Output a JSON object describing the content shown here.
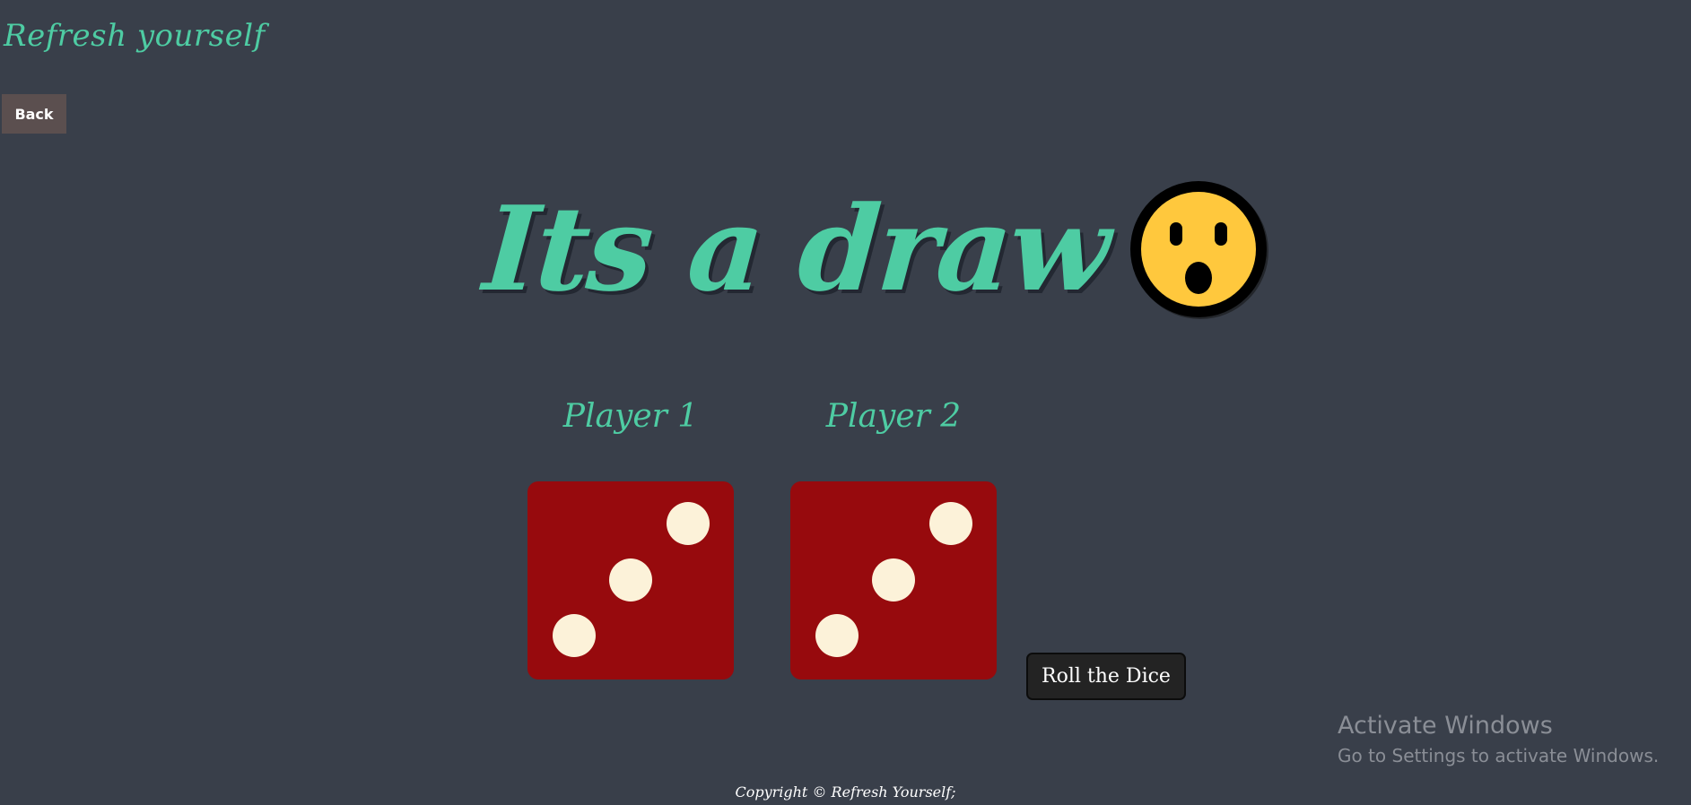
{
  "header": {
    "brand": "Refresh yourself",
    "back_label": "Back"
  },
  "result": {
    "headline": "Its a draw",
    "emoji": "astonished-face-emoji"
  },
  "players": [
    {
      "label": "Player 1",
      "die_value": 3
    },
    {
      "label": "Player 2",
      "die_value": 3
    }
  ],
  "controls": {
    "roll_label": "Roll the Dice"
  },
  "watermark": {
    "title": "Activate Windows",
    "subtitle": "Go to Settings to activate Windows."
  },
  "footer": {
    "copyright": "Copyright © Refresh Yourself;"
  },
  "colors": {
    "background": "#393f4a",
    "accent": "#4ecca3",
    "die_face": "#970a0d",
    "die_pip": "#fcf2d9",
    "emoji_face": "#ffc83d"
  }
}
